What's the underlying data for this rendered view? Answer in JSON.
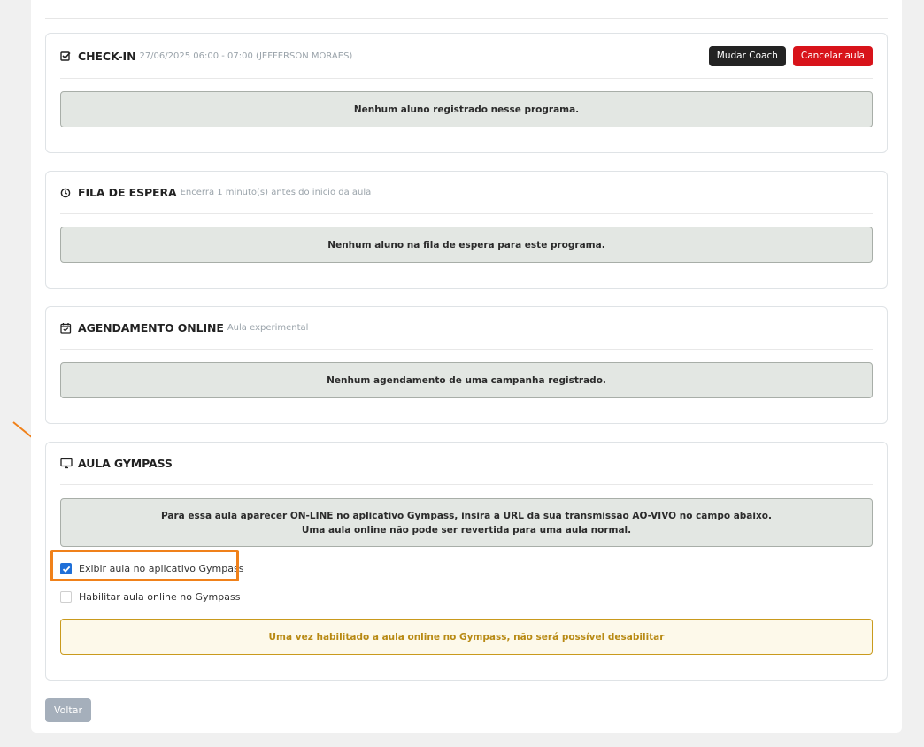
{
  "checkin": {
    "title": "CHECK-IN",
    "subtitle": "27/06/2025 06:00 - 07:00 (JEFFERSON MORAES)",
    "icon": "checkbox-check-icon",
    "change_coach_label": "Mudar Coach",
    "cancel_class_label": "Cancelar aula",
    "empty_message": "Nenhum aluno registrado nesse programa."
  },
  "waitlist": {
    "title": "FILA DE ESPERA",
    "subtitle": "Encerra 1 minuto(s) antes do inicio da aula",
    "icon": "clock-icon",
    "empty_message": "Nenhum aluno na fila de espera para este programa."
  },
  "online_booking": {
    "title": "AGENDAMENTO ONLINE",
    "subtitle": "Aula experimental",
    "icon": "calendar-check-icon",
    "empty_message": "Nenhum agendamento de uma campanha registrado."
  },
  "gympass": {
    "title": "AULA GYMPASS",
    "icon": "monitor-icon",
    "info_line1": "Para essa aula aparecer ON-LINE no aplicativo Gympass, insira a URL da sua transmissão AO-VIVO no campo abaixo.",
    "info_line2": "Uma aula online não pode ser revertida para uma aula normal.",
    "show_in_app_label": "Exibir aula no aplicativo Gympass",
    "show_in_app_checked": true,
    "enable_online_label": "Habilitar aula online no Gympass",
    "enable_online_checked": false,
    "warning": "Uma vez habilitado a aula online no Gympass, não será possível desabilitar"
  },
  "footer": {
    "back_label": "Voltar"
  },
  "colors": {
    "accent_highlight": "#f0811a",
    "danger": "#d8131a",
    "dark_button": "#232323",
    "checkbox_checked": "#1e6fd8",
    "warning_text": "#b88a14"
  }
}
